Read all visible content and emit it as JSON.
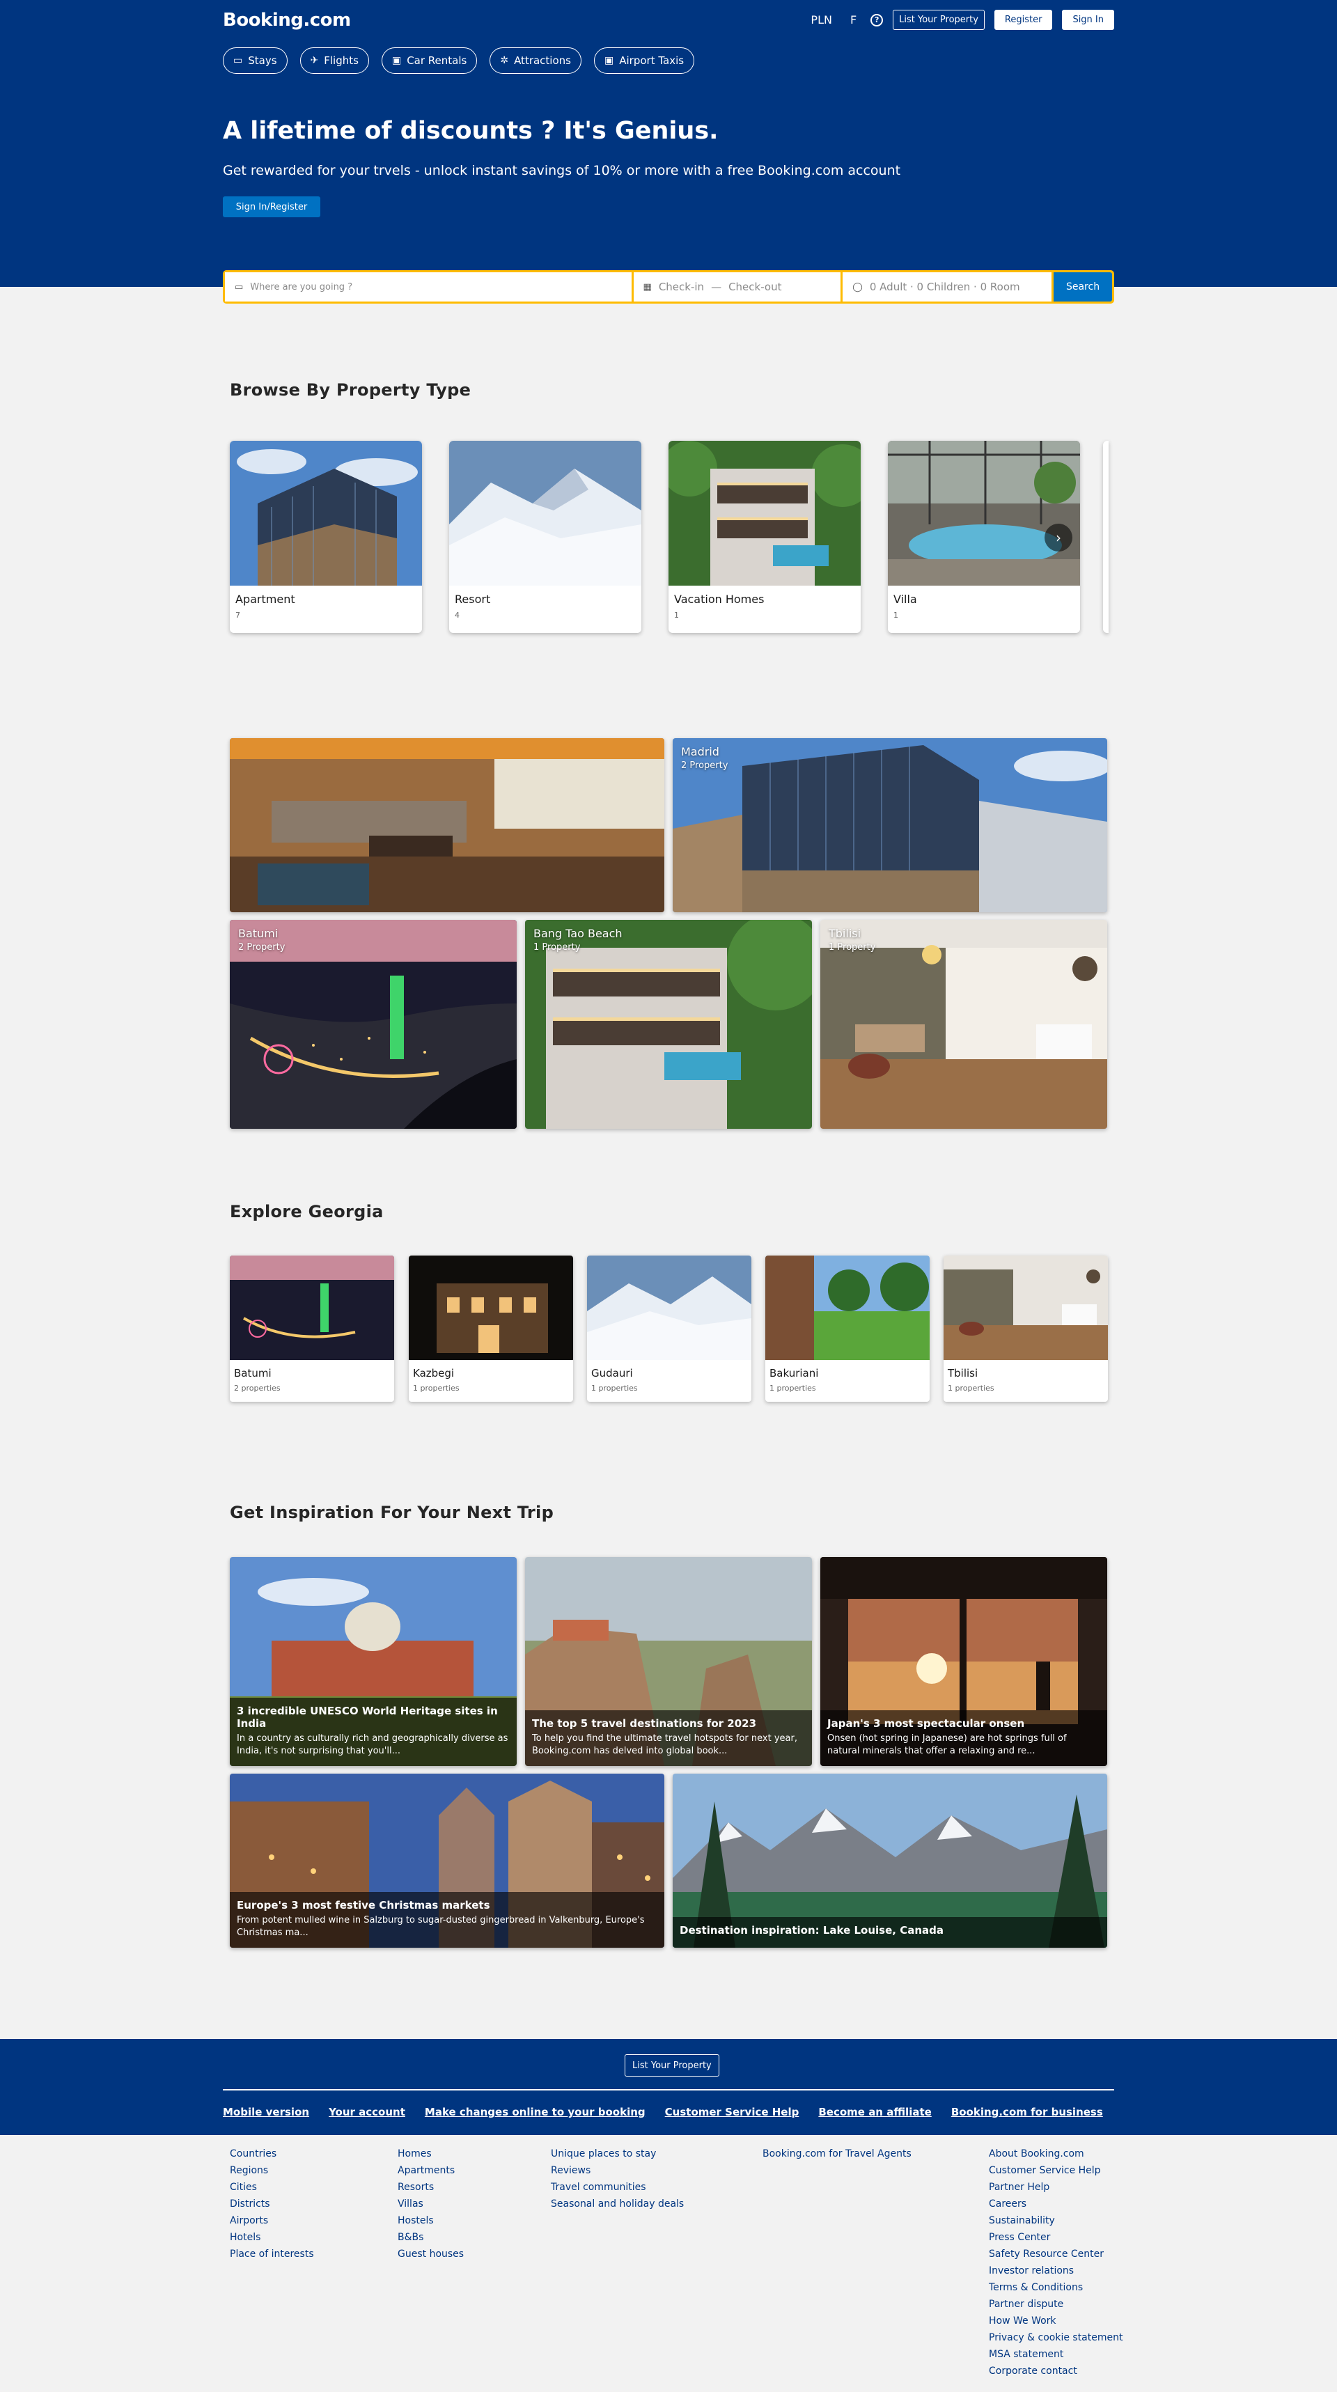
{
  "header": {
    "brand": "Booking.com",
    "currency": "PLN",
    "language": "F",
    "help_icon": "question-icon",
    "list_property": "List Your Property",
    "register": "Register",
    "sign_in": "Sign In",
    "nav": [
      {
        "label": "Stays",
        "icon": "bed-icon"
      },
      {
        "label": "Flights",
        "icon": "plane-icon"
      },
      {
        "label": "Car Rentals",
        "icon": "car-icon"
      },
      {
        "label": "Attractions",
        "icon": "attraction-icon"
      },
      {
        "label": "Airport Taxis",
        "icon": "taxi-icon"
      }
    ]
  },
  "hero": {
    "title": "A lifetime of discounts ? It's Genius.",
    "subtitle": "Get rewarded for your trvels - unlock instant savings of 10% or more with a free Booking.com account",
    "button": "Sign In/Register"
  },
  "search": {
    "destination_placeholder": "Where are you going ?",
    "checkin": "Check-in",
    "separator": "—",
    "checkout": "Check-out",
    "guests": "0 Adult · 0 Children · 0 Room",
    "button": "Search"
  },
  "property_types": {
    "title": "Browse By Property Type",
    "items": [
      {
        "name": "Apartment",
        "count": "7"
      },
      {
        "name": "Resort",
        "count": "4"
      },
      {
        "name": "Vacation Homes",
        "count": "1"
      },
      {
        "name": "Villa",
        "count": "1"
      }
    ]
  },
  "destinations": [
    {
      "name": "",
      "count": ""
    },
    {
      "name": "Madrid",
      "count": "2 Property"
    },
    {
      "name": "Batumi",
      "count": "2 Property"
    },
    {
      "name": "Bang Tao Beach",
      "count": "1 Property"
    },
    {
      "name": "Tbilisi",
      "count": "1 Property"
    }
  ],
  "georgia": {
    "title": "Explore Georgia",
    "items": [
      {
        "name": "Batumi",
        "count": "2 properties"
      },
      {
        "name": "Kazbegi",
        "count": "1 properties"
      },
      {
        "name": "Gudauri",
        "count": "1 properties"
      },
      {
        "name": "Bakuriani",
        "count": "1 properties"
      },
      {
        "name": "Tbilisi",
        "count": "1 properties"
      }
    ]
  },
  "inspiration": {
    "title": "Get Inspiration For Your Next Trip",
    "items": [
      {
        "title": "3 incredible UNESCO World Heritage sites in India",
        "text": "In a country as culturally rich and geographically diverse as India, it's not surprising that you'll..."
      },
      {
        "title": "The top 5 travel destinations for 2023",
        "text": "To help you find the ultimate travel hotspots for next year, Booking.com has delved into global book..."
      },
      {
        "title": "Japan's 3 most spectacular onsen",
        "text": "Onsen (hot spring in Japanese) are hot springs full of natural minerals that offer a relaxing and re..."
      },
      {
        "title": "Europe's 3 most festive Christmas markets",
        "text": "From potent mulled wine in Salzburg to sugar-dusted gingerbread in Valkenburg, Europe's Christmas ma..."
      },
      {
        "title": "Destination inspiration: Lake Louise, Canada",
        "text": ""
      }
    ]
  },
  "footer": {
    "list_property": "List Your Property",
    "links": [
      "Mobile version",
      "Your account",
      "Make changes online to your booking",
      "Customer Service Help",
      "Become an affiliate",
      "Booking.com for business"
    ],
    "col1": [
      "Countries",
      "Regions",
      "Cities",
      "Districts",
      "Airports",
      "Hotels",
      "Place of interests"
    ],
    "col2": [
      "Homes",
      "Apartments",
      "Resorts",
      "Villas",
      "Hostels",
      "B&Bs",
      "Guest houses"
    ],
    "col3": [
      "Unique places to stay",
      "Reviews",
      "Travel communities",
      "Seasonal and holiday deals"
    ],
    "col4": [
      "Booking.com for Travel Agents"
    ],
    "col5": [
      "About Booking.com",
      "Customer Service Help",
      "Partner Help",
      "Careers",
      "Sustainability",
      "Press Center",
      "Safety Resource Center",
      "Investor relations",
      "Terms & Conditions",
      "Partner dispute",
      "How We Work",
      "Privacy & cookie statement",
      "MSA statement",
      "Corporate contact"
    ]
  }
}
